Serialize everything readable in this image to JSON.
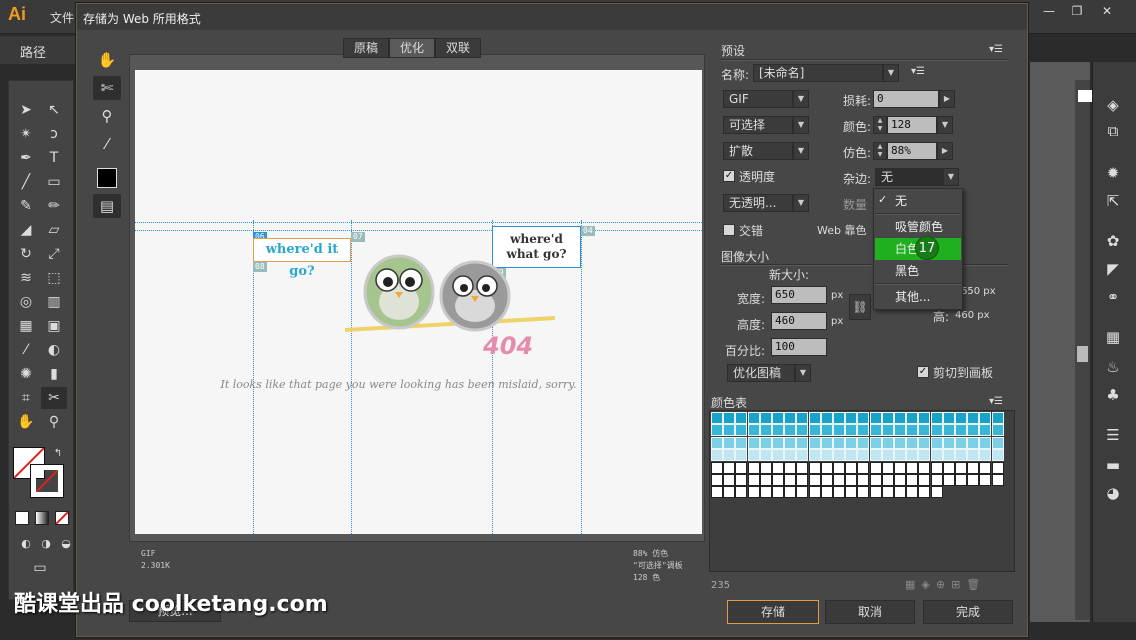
{
  "app": {
    "logo": "Ai",
    "menu_file": "文件",
    "path_label": "路径",
    "win_min": "—",
    "win_max": "❐",
    "win_close": "✕"
  },
  "dialog": {
    "title": "存储为 Web 所用格式",
    "tabs": [
      "原稿",
      "优化",
      "双联"
    ],
    "preview": {
      "bubble1": "where'd it go?",
      "bubble2_line1": "where'd",
      "bubble2_line2": "what go?",
      "text_404": "404",
      "lost_msg": "It looks like that page you were looking has been mislaid, sorry.",
      "slice_labels": [
        "06",
        "07",
        "08",
        "03",
        "04",
        "09"
      ],
      "info_left": "GIF\n2.301K",
      "info_right": "88% 仿色\n\"可选择\"调板\n128 色"
    },
    "preview_button": "预览...",
    "preset": {
      "title": "预设",
      "name_label": "名称:",
      "name_value": "[未命名]",
      "format": "GIF",
      "lossy_label": "损耗:",
      "lossy_value": "0",
      "reduction": "可选择",
      "colors_label": "颜色:",
      "colors_value": "128",
      "dither_algo": "扩散",
      "dither_label": "仿色:",
      "dither_value": "88%",
      "transparency_label": "透明度",
      "matte_label": "杂边:",
      "matte_value": "无",
      "trans_dither": "无透明...",
      "amount_label": "数量",
      "interlaced_label": "交错",
      "web_snap_label": "Web 靠色"
    },
    "matte_menu": {
      "items": [
        "无",
        "吸管颜色",
        "白色",
        "黑色",
        "其他..."
      ],
      "checked": "无",
      "highlighted": "白色",
      "cursor_step": "17"
    },
    "image_size": {
      "title": "图像大小",
      "new_size_label": "新大小:",
      "width_label": "宽度:",
      "width_value": "650",
      "height_label": "高度:",
      "height_value": "460",
      "unit": "px",
      "percent_label": "百分比:",
      "percent_value": "100",
      "orig_width": "650 px",
      "orig_height_label": "高:",
      "orig_height": "460 px",
      "quality": "优化图稿",
      "clip_label": "剪切到画板"
    },
    "color_table": {
      "title": "颜色表",
      "count": "235"
    },
    "buttons": {
      "save": "存储",
      "cancel": "取消",
      "done": "完成"
    }
  },
  "watermark": "酷课堂出品 coolketang.com",
  "colors": {
    "accent_orange": "#e09a4a",
    "highlight_green": "#1faf1f",
    "slice_blue": "#2e8fd4"
  }
}
